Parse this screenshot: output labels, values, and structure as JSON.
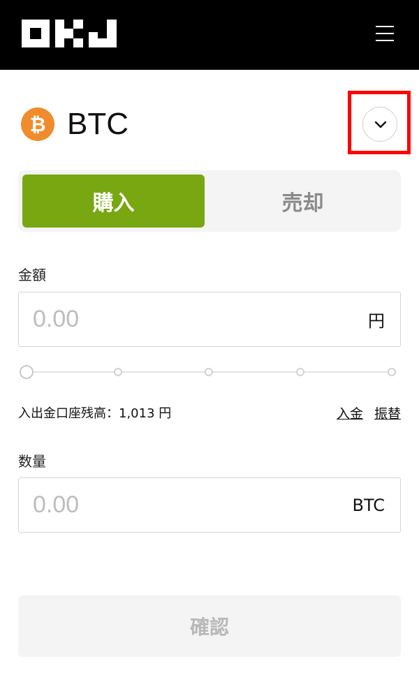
{
  "header": {
    "logo_text": "OKJ",
    "menu_icon": "hamburger-menu-icon"
  },
  "coin": {
    "symbol": "BTC",
    "icon_glyph": "₿",
    "icon_color": "#f08c2b",
    "dropdown_icon": "chevron-down-icon"
  },
  "tabs": {
    "buy_label": "購入",
    "sell_label": "売却",
    "active": "buy",
    "active_color": "#78a712"
  },
  "amount": {
    "label": "金額",
    "placeholder": "0.00",
    "unit": "円"
  },
  "slider": {
    "value_percent": 0,
    "steps": [
      0,
      25,
      50,
      75,
      100
    ]
  },
  "balance": {
    "text": "入出金口座残高：1,013 円",
    "deposit_link": "入金",
    "transfer_link": "振替"
  },
  "quantity": {
    "label": "数量",
    "placeholder": "0.00",
    "unit": "BTC"
  },
  "confirm": {
    "label": "確認"
  },
  "highlight_color": "#ff0000"
}
